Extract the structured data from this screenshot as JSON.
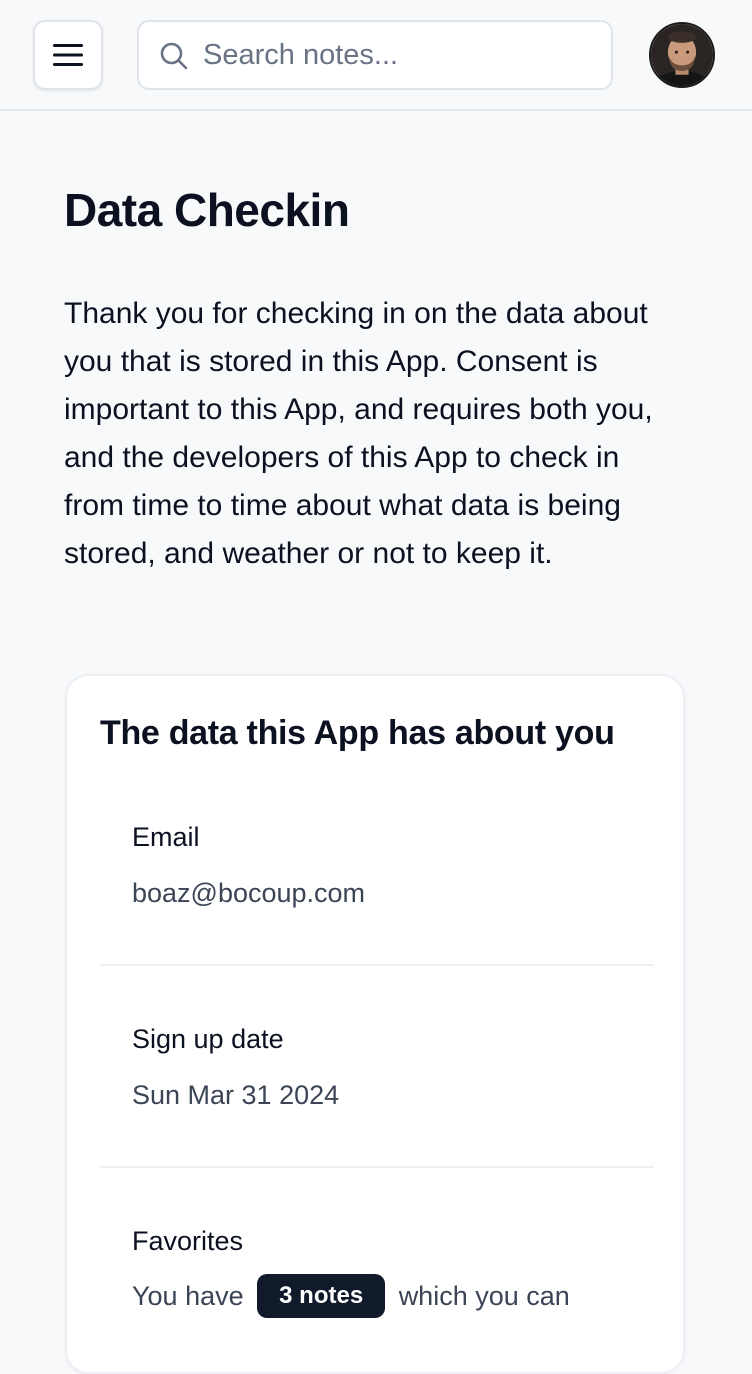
{
  "header": {
    "menu_icon": "hamburger-menu-icon",
    "search": {
      "icon": "search-icon",
      "placeholder": "Search notes...",
      "value": ""
    },
    "avatar_icon": "user-avatar"
  },
  "main": {
    "title": "Data Checkin",
    "intro": "Thank you for checking in on the data about you that is stored in this App. Consent is important to this App, and requires both you, and the developers of this App to check in from time to time about what data is being stored, and weather or not to keep it."
  },
  "data_card": {
    "title": "The data this App has about you",
    "fields": [
      {
        "label": "Email",
        "value": "boaz@bocoup.com"
      },
      {
        "label": "Sign up date",
        "value": "Sun Mar 31 2024"
      }
    ],
    "favorites": {
      "label": "Favorites",
      "text_before": "You have",
      "badge": "3 notes",
      "text_after": "which you can"
    }
  },
  "colors": {
    "background": "#f8f9fb",
    "text": "#0b1120",
    "muted_text": "#3b4556",
    "badge_bg": "#101a2b",
    "border": "#dfe3ea"
  }
}
